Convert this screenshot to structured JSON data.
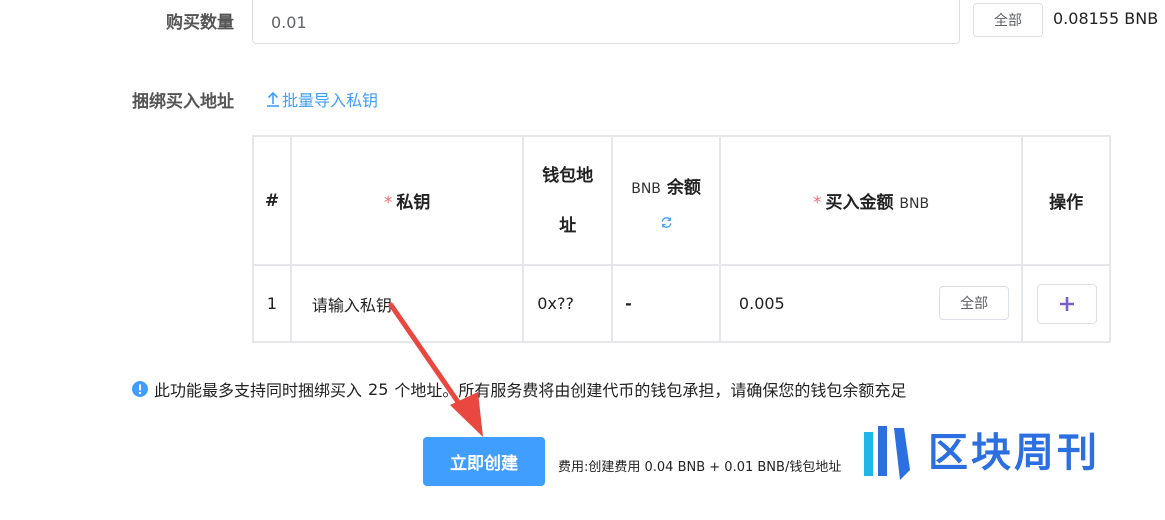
{
  "quantity": {
    "label": "购买数量",
    "value": "0.01",
    "all_button": "全部",
    "balance": "0.08155 BNB"
  },
  "bind": {
    "label": "捆绑买入地址",
    "import_link": "批量导入私钥"
  },
  "table": {
    "headers": {
      "index": "#",
      "private_key": "私钥",
      "wallet_addr_line1": "钱包地",
      "wallet_addr_line2": "址",
      "balance_prefix": "BNB",
      "balance_label": "余额",
      "buy_amount": "买入金额",
      "buy_amount_unit": "BNB",
      "actions": "操作"
    },
    "rows": [
      {
        "index": "1",
        "private_key_placeholder": "请输入私钥",
        "address": "0x??",
        "balance": "-",
        "amount": "0.005",
        "all_button": "全部"
      }
    ]
  },
  "notice": {
    "text_before": "此功能最多支持同时捆绑买入",
    "count": "25",
    "text_after": "个地址。所有服务费将由创建代币的钱包承担，请确保您的钱包余额充足"
  },
  "create_button": "立即创建",
  "fee_text": "费用:创建费用 0.04 BNB + 0.01 BNB/钱包地址",
  "watermark": "区块周刊",
  "colors": {
    "primary": "#409eff",
    "required": "#f56c6c",
    "arrow": "#e8483f",
    "plus": "#7b5fc7"
  }
}
